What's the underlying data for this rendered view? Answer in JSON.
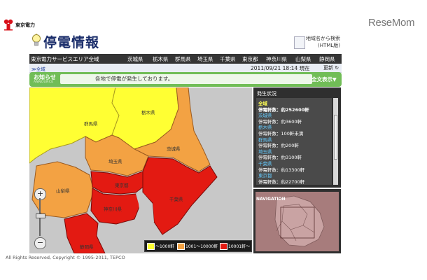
{
  "company": {
    "name": "東京電力"
  },
  "watermark": "ReseMom",
  "app": {
    "title": "停電情報"
  },
  "html_link": {
    "line1": "地域名から検索",
    "line2": "(HTML版)"
  },
  "nav": {
    "service_area": "東京電力サービスエリア全域",
    "prefectures": [
      "茨城県",
      "栃木県",
      "群馬県",
      "埼玉県",
      "千葉県",
      "東京都",
      "神奈川県",
      "山梨県",
      "静岡県"
    ]
  },
  "breadcrumb": "≫全域",
  "timestamp": "2011/09/21 18:14 現在",
  "refresh_label": "更新",
  "announce": {
    "label": "お知らせ",
    "sublabel": "ANNOUNCE",
    "message": "各地で停電が発生しております。",
    "view_all": "全文表示▼"
  },
  "map": {
    "labels": [
      "栃木県",
      "群馬県",
      "茨城県",
      "埼玉県",
      "山梨県",
      "東京都",
      "千葉県",
      "神奈川県",
      "静岡県"
    ],
    "zoom_in": "+",
    "zoom_out": "−"
  },
  "legend": {
    "items": [
      {
        "label": "〜1000軒",
        "color": "#ffff33"
      },
      {
        "label": "1001〜10000軒",
        "color": "#f3a243"
      },
      {
        "label": "10001軒〜",
        "color": "#e31a12"
      }
    ]
  },
  "status": {
    "heading": "発生状況",
    "rows": [
      {
        "text": "全域",
        "color": "#ffff55",
        "bold": true
      },
      {
        "text": "停電軒数：約252600軒",
        "color": "#ffffff",
        "bold": true
      },
      {
        "text": "茨城県",
        "color": "#66ccff"
      },
      {
        "text": "停電軒数：約3600軒",
        "color": "#ffffff"
      },
      {
        "text": "栃木県",
        "color": "#66ccff"
      },
      {
        "text": "停電軒数：100軒未満",
        "color": "#ffffff"
      },
      {
        "text": "群馬県",
        "color": "#66ccff"
      },
      {
        "text": "停電軒数：約200軒",
        "color": "#ffffff"
      },
      {
        "text": "埼玉県",
        "color": "#66ccff"
      },
      {
        "text": "停電軒数：約3100軒",
        "color": "#ffffff"
      },
      {
        "text": "千葉県",
        "color": "#66ccff"
      },
      {
        "text": "停電軒数：約13300軒",
        "color": "#ffffff"
      },
      {
        "text": "東京都",
        "color": "#66ccff"
      },
      {
        "text": "停電軒数：約22700軒",
        "color": "#ffffff"
      }
    ]
  },
  "navigation": {
    "label": "NAVIGATION"
  },
  "footer": "All Rights Reserved, Copyright © 1995-2011, TEPCO",
  "colors": {
    "yellow": "#ffff33",
    "orange": "#f3a243",
    "red": "#e31a12",
    "nav_bar": "#353535",
    "announce": "#71bd57",
    "title": "#1b2e6b"
  }
}
